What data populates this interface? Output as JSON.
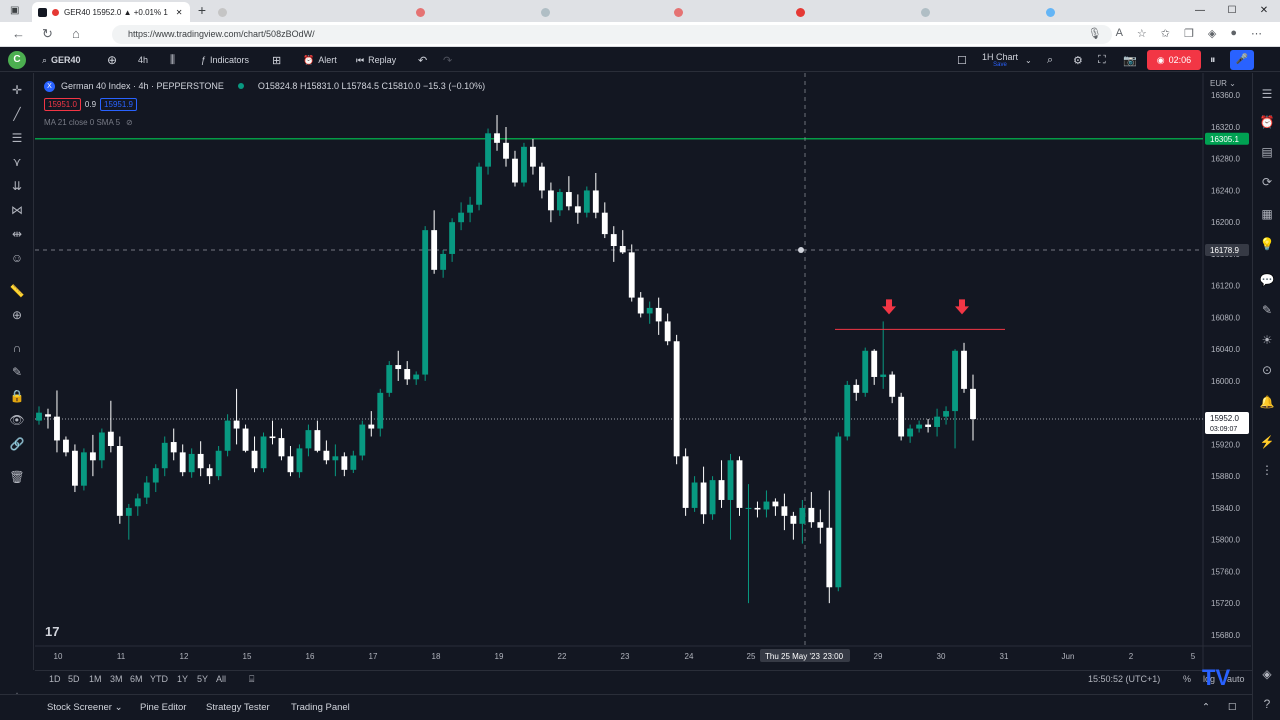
{
  "browser": {
    "active_tab_title": "GER40 15952.0 ▲ +0.01% 1",
    "url": "https://www.tradingview.com/chart/508zBOdW/",
    "new_tab": "+"
  },
  "toolbar": {
    "symbol": "GER40",
    "interval": "4h",
    "indicators": "Indicators",
    "alert": "Alert",
    "replay": "Replay",
    "layout_name": "1H Chart",
    "layout_sub": "Save",
    "record_time": "02:06"
  },
  "legend": {
    "title": "German 40 Index · 4h · PEPPERSTONE",
    "ohlc": "O15824.8 H15831.0 L15784.5 C15810.0 −15.3 (−0.10%)",
    "sell": "15951.0",
    "spread": "0.9",
    "buy": "15951.9",
    "ma": "MA 21 close 0 SMA 5"
  },
  "axis": {
    "currency": "EUR",
    "green_line_label": "16305.1",
    "crosshair_label": "16178.9",
    "last_price_label": "15952.0",
    "countdown_label": "03:09:07",
    "crosshair_date": "Thu 25 May '23",
    "crosshair_time": "23:00"
  },
  "chart_data": {
    "type": "candlestick",
    "y_ticks": [
      16360,
      16320,
      16280,
      16240,
      16200,
      16160,
      16120,
      16080,
      16040,
      16000,
      15920,
      15880,
      15840,
      15800,
      15760,
      15720,
      15680
    ],
    "ylim": [
      15666,
      16388
    ],
    "x_ticks": [
      "10",
      "11",
      "12",
      "15",
      "16",
      "17",
      "18",
      "19",
      "22",
      "23",
      "24",
      "25",
      "29",
      "30",
      "31",
      "Jun",
      "2",
      "5"
    ],
    "horizontal_levels": [
      {
        "value": 16305.1,
        "color": "#00c853"
      },
      {
        "value": 16065,
        "color": "#f23645"
      }
    ],
    "markers": [
      "down-arrow",
      "down-arrow"
    ],
    "candles": [
      [
        15950,
        15968,
        15945,
        15960
      ],
      [
        15958,
        15965,
        15940,
        15955
      ],
      [
        15955,
        15988,
        15910,
        15925
      ],
      [
        15926,
        15930,
        15905,
        15910
      ],
      [
        15912,
        15920,
        15860,
        15868
      ],
      [
        15868,
        15915,
        15862,
        15910
      ],
      [
        15910,
        15932,
        15880,
        15900
      ],
      [
        15900,
        15940,
        15890,
        15935
      ],
      [
        15936,
        15975,
        15910,
        15918
      ],
      [
        15918,
        15930,
        15820,
        15830
      ],
      [
        15830,
        15845,
        15800,
        15840
      ],
      [
        15842,
        15858,
        15830,
        15852
      ],
      [
        15853,
        15880,
        15845,
        15872
      ],
      [
        15872,
        15895,
        15860,
        15890
      ],
      [
        15890,
        15930,
        15880,
        15922
      ],
      [
        15923,
        15940,
        15900,
        15910
      ],
      [
        15910,
        15920,
        15880,
        15885
      ],
      [
        15885,
        15915,
        15878,
        15908
      ],
      [
        15908,
        15924,
        15880,
        15890
      ],
      [
        15890,
        15895,
        15870,
        15880
      ],
      [
        15880,
        15918,
        15875,
        15912
      ],
      [
        15912,
        15958,
        15905,
        15950
      ],
      [
        15950,
        15990,
        15920,
        15940
      ],
      [
        15940,
        15945,
        15910,
        15912
      ],
      [
        15912,
        15930,
        15885,
        15890
      ],
      [
        15890,
        15935,
        15885,
        15930
      ],
      [
        15930,
        15950,
        15920,
        15928
      ],
      [
        15928,
        15940,
        15900,
        15905
      ],
      [
        15905,
        15918,
        15880,
        15885
      ],
      [
        15885,
        15920,
        15878,
        15915
      ],
      [
        15915,
        15945,
        15905,
        15938
      ],
      [
        15938,
        15950,
        15910,
        15912
      ],
      [
        15912,
        15925,
        15895,
        15900
      ],
      [
        15900,
        15920,
        15880,
        15905
      ],
      [
        15905,
        15910,
        15880,
        15888
      ],
      [
        15888,
        15912,
        15884,
        15906
      ],
      [
        15906,
        15950,
        15900,
        15945
      ],
      [
        15945,
        15962,
        15930,
        15940
      ],
      [
        15940,
        15990,
        15930,
        15985
      ],
      [
        15985,
        16025,
        15980,
        16020
      ],
      [
        16020,
        16038,
        16000,
        16015
      ],
      [
        16015,
        16025,
        15995,
        16002
      ],
      [
        16002,
        16012,
        15995,
        16008
      ],
      [
        16008,
        16195,
        16000,
        16190
      ],
      [
        16190,
        16215,
        16135,
        16140
      ],
      [
        16140,
        16165,
        16130,
        16160
      ],
      [
        16160,
        16205,
        16150,
        16200
      ],
      [
        16200,
        16225,
        16190,
        16212
      ],
      [
        16212,
        16232,
        16200,
        16222
      ],
      [
        16222,
        16275,
        16215,
        16270
      ],
      [
        16270,
        16318,
        16260,
        16312
      ],
      [
        16312,
        16335,
        16290,
        16300
      ],
      [
        16300,
        16320,
        16270,
        16280
      ],
      [
        16280,
        16290,
        16245,
        16250
      ],
      [
        16250,
        16300,
        16245,
        16295
      ],
      [
        16295,
        16305,
        16260,
        16270
      ],
      [
        16270,
        16275,
        16230,
        16240
      ],
      [
        16240,
        16250,
        16200,
        16215
      ],
      [
        16215,
        16242,
        16208,
        16238
      ],
      [
        16238,
        16258,
        16215,
        16220
      ],
      [
        16220,
        16235,
        16198,
        16212
      ],
      [
        16212,
        16245,
        16206,
        16240
      ],
      [
        16240,
        16262,
        16205,
        16212
      ],
      [
        16212,
        16225,
        16180,
        16185
      ],
      [
        16185,
        16195,
        16150,
        16170
      ],
      [
        16170,
        16190,
        16160,
        16162
      ],
      [
        16162,
        16172,
        16100,
        16105
      ],
      [
        16105,
        16112,
        16080,
        16085
      ],
      [
        16085,
        16100,
        16072,
        16092
      ],
      [
        16092,
        16105,
        16058,
        16075
      ],
      [
        16075,
        16085,
        16045,
        16050
      ],
      [
        16050,
        16058,
        15895,
        15905
      ],
      [
        15905,
        15915,
        15830,
        15840
      ],
      [
        15840,
        15880,
        15835,
        15872
      ],
      [
        15872,
        15892,
        15820,
        15832
      ],
      [
        15832,
        15880,
        15825,
        15875
      ],
      [
        15875,
        15900,
        15840,
        15850
      ],
      [
        15850,
        15908,
        15800,
        15900
      ],
      [
        15900,
        15905,
        15830,
        15840
      ],
      [
        15840,
        15870,
        15720,
        15840
      ],
      [
        15840,
        15848,
        15828,
        15838
      ],
      [
        15838,
        15862,
        15828,
        15848
      ],
      [
        15848,
        15852,
        15830,
        15842
      ],
      [
        15842,
        15858,
        15812,
        15830
      ],
      [
        15830,
        15835,
        15800,
        15820
      ],
      [
        15820,
        15850,
        15795,
        15840
      ],
      [
        15840,
        15860,
        15815,
        15822
      ],
      [
        15822,
        15838,
        15795,
        15815
      ],
      [
        15815,
        15862,
        15720,
        15740
      ],
      [
        15740,
        15935,
        15735,
        15930
      ],
      [
        15930,
        16000,
        15925,
        15995
      ],
      [
        15995,
        16002,
        15975,
        15985
      ],
      [
        15985,
        16042,
        15980,
        16038
      ],
      [
        16038,
        16040,
        15995,
        16005
      ],
      [
        16005,
        16075,
        15990,
        16008
      ],
      [
        16008,
        16012,
        15972,
        15980
      ],
      [
        15980,
        15985,
        15925,
        15930
      ],
      [
        15930,
        15945,
        15922,
        15940
      ],
      [
        15940,
        15950,
        15935,
        15945
      ],
      [
        15945,
        15952,
        15935,
        15942
      ],
      [
        15942,
        15965,
        15930,
        15955
      ],
      [
        15955,
        15968,
        15945,
        15962
      ],
      [
        15962,
        16040,
        15915,
        16038
      ],
      [
        16038,
        16048,
        15985,
        15990
      ],
      [
        15990,
        16008,
        15925,
        15952
      ]
    ]
  }
}
